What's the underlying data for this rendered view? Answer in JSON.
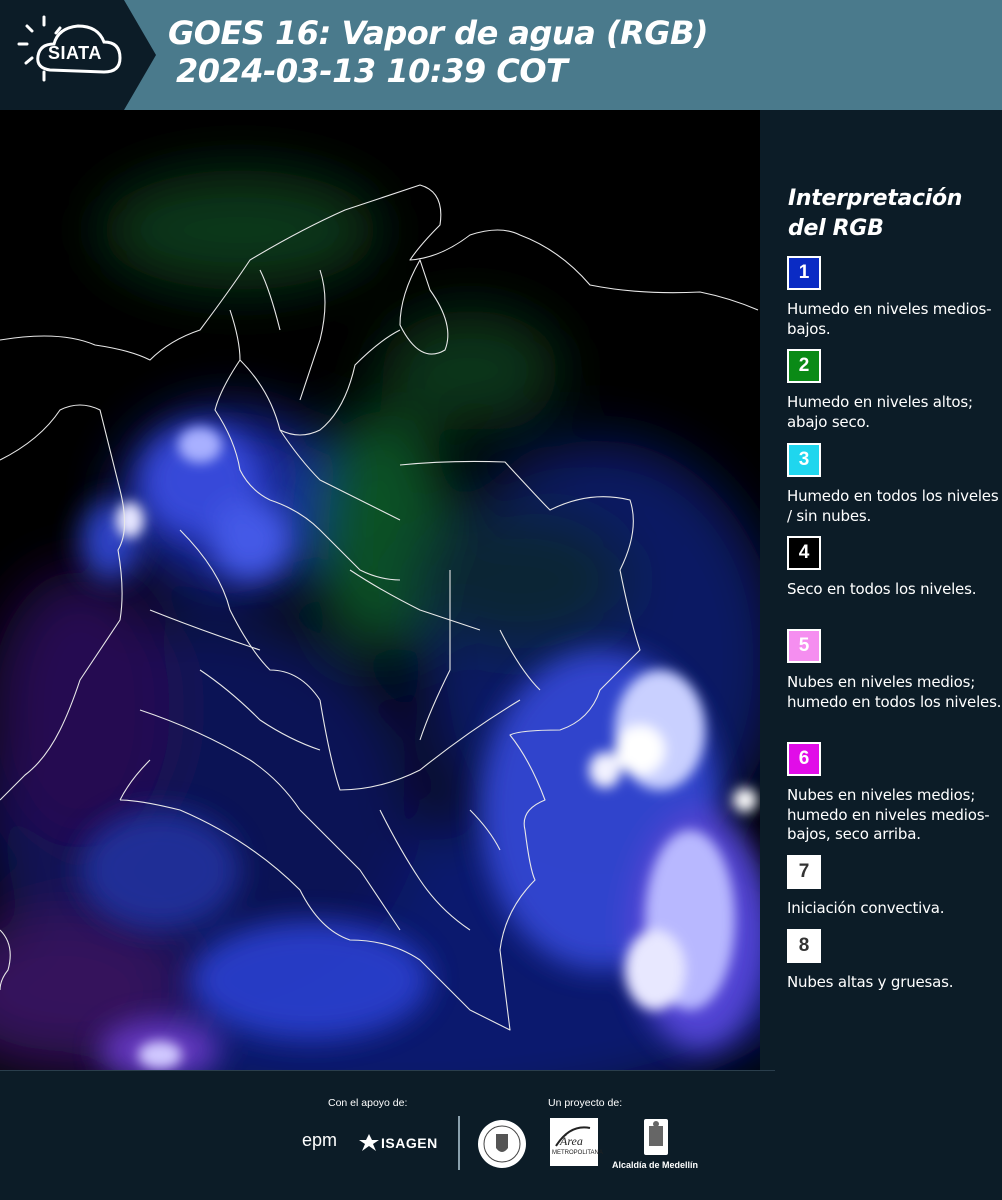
{
  "header": {
    "logo_text": "SIATA",
    "title_line1": "GOES 16: Vapor de agua (RGB)",
    "title_line2": "2024-03-13 10:39 COT"
  },
  "legend": {
    "title_line1": "Interpretación",
    "title_line2": "del RGB",
    "items": [
      {
        "number": "1",
        "color": "#0a2bc4",
        "text_color": "#ffffff",
        "description": "Humedo en niveles medios-bajos."
      },
      {
        "number": "2",
        "color": "#0a8a16",
        "text_color": "#ffffff",
        "description": "Humedo en niveles altos; abajo seco."
      },
      {
        "number": "3",
        "color": "#1fd6ee",
        "text_color": "#ffffff",
        "description": "Humedo en todos los niveles / sin nubes."
      },
      {
        "number": "4",
        "color": "#000000",
        "text_color": "#ffffff",
        "description": "Seco en todos los niveles."
      },
      {
        "number": "5",
        "color": "#f58ef0",
        "text_color": "#ffffff",
        "description": "Nubes en niveles medios; humedo en todos los niveles."
      },
      {
        "number": "6",
        "color": "#e10ce8",
        "text_color": "#ffffff",
        "description": "Nubes en niveles medios; humedo en niveles medios-bajos, seco arriba."
      },
      {
        "number": "7",
        "color": "#ffffff",
        "text_color": "#333333",
        "description": "Iniciación convectiva."
      },
      {
        "number": "8",
        "color": "#ffffff",
        "text_color": "#333333",
        "description": "Nubes altas y gruesas."
      }
    ]
  },
  "footer": {
    "support_label": "Con el apoyo de:",
    "project_label": "Un proyecto de:",
    "epm": "epm",
    "isagen": "ISAGEN",
    "area_name": "METROPOLITANA",
    "alcaldia": "Alcaldía de Medellín"
  },
  "colors": {
    "header_bg": "#4a7a8c",
    "logo_bg": "#0c1c27",
    "panel_bg": "#0c1c27"
  }
}
